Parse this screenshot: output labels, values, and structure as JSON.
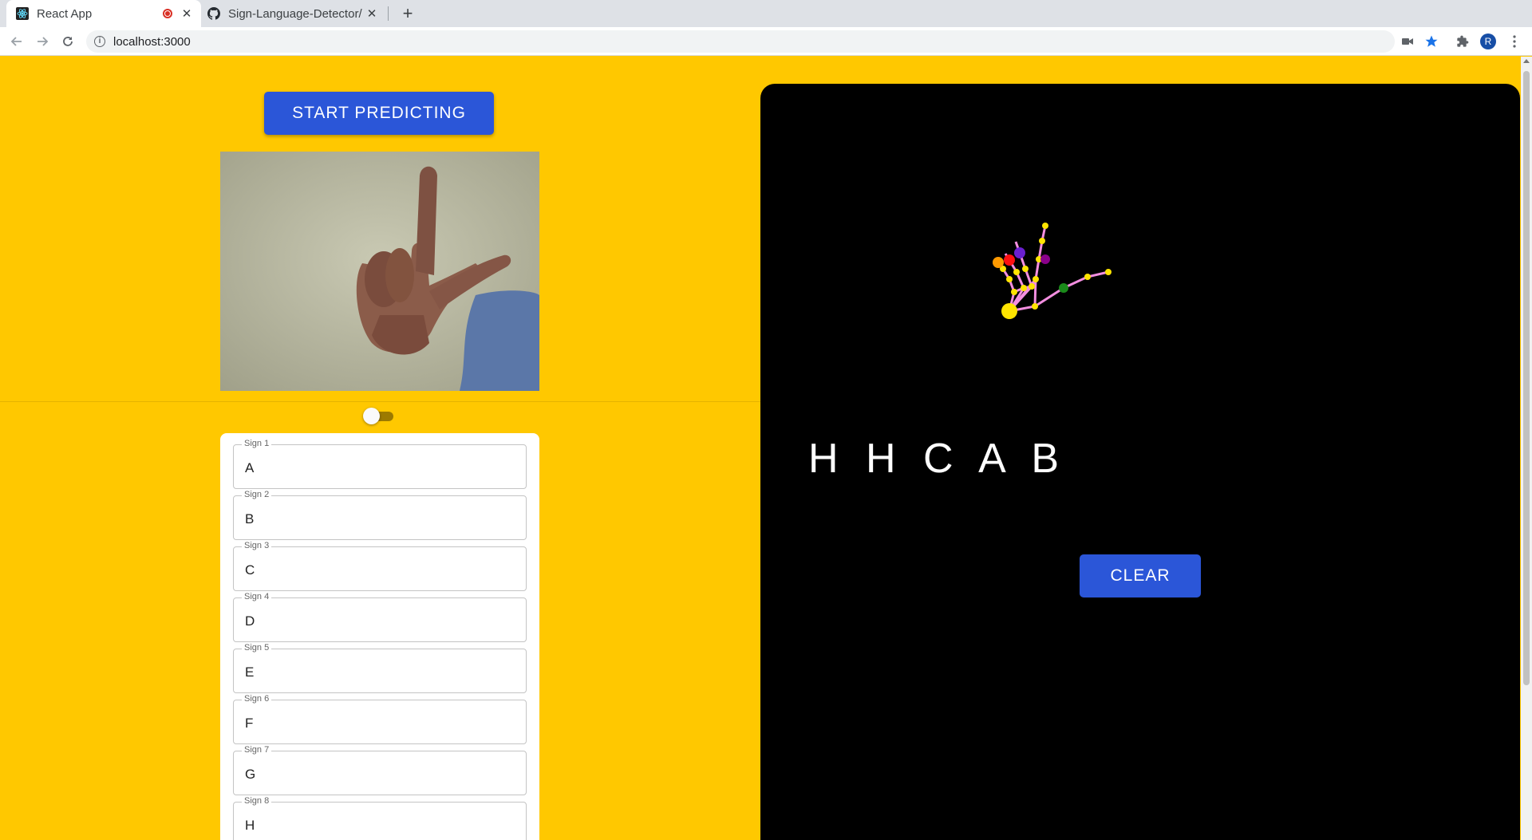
{
  "browser": {
    "tabs": [
      {
        "title": "React App",
        "recording": true
      },
      {
        "title": "Sign-Language-Detector/"
      }
    ],
    "url": "localhost:3000",
    "profile_initial": "R"
  },
  "controls": {
    "start_label": "START PREDICTING",
    "clear_label": "CLEAR",
    "toggle_on": false
  },
  "signs": [
    {
      "label": "Sign 1",
      "value": "A"
    },
    {
      "label": "Sign 2",
      "value": "B"
    },
    {
      "label": "Sign 3",
      "value": "C"
    },
    {
      "label": "Sign 4",
      "value": "D"
    },
    {
      "label": "Sign 5",
      "value": "E"
    },
    {
      "label": "Sign 6",
      "value": "F"
    },
    {
      "label": "Sign 7",
      "value": "G"
    },
    {
      "label": "Sign 8",
      "value": "H"
    }
  ],
  "output": {
    "predicted_text": "HHCAB"
  },
  "colors": {
    "page_bg": "#ffc800",
    "button_blue": "#2b56d8",
    "output_bg": "#000000",
    "bone": "#f38ee0",
    "joint": "#ffe400"
  }
}
